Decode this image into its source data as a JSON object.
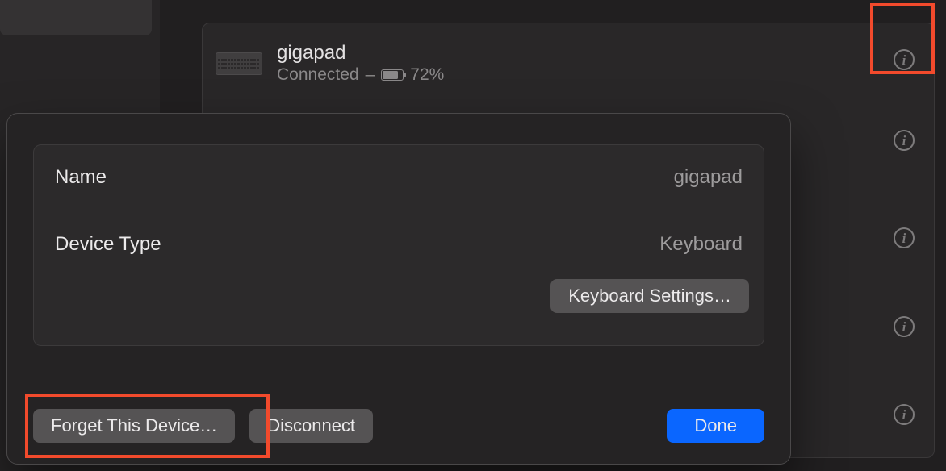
{
  "device": {
    "name": "gigapad",
    "status": "Connected",
    "dash": " – ",
    "battery_pct": "72%"
  },
  "sheet": {
    "name_label": "Name",
    "name_value": "gigapad",
    "type_label": "Device Type",
    "type_value": "Keyboard",
    "keyboard_settings": "Keyboard Settings…",
    "forget": "Forget This Device…",
    "disconnect": "Disconnect",
    "done": "Done"
  },
  "info_glyph": "i"
}
